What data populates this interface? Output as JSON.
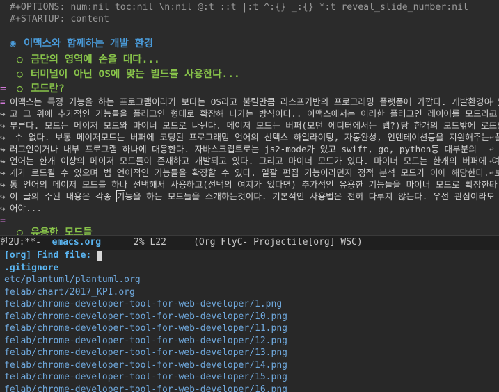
{
  "editor": {
    "options_line": "#+OPTIONS: num:nil toc:nil \\n:nil @:t ::t |:t ^:{} _:{} *:t reveal_slide_number:nil",
    "startup_line": "#+STARTUP: content",
    "h1": {
      "bullet": "◉",
      "text": "이맥스와 함께하는 개발 환경"
    },
    "h2a": {
      "bullet": "○",
      "text": "금단의 영역에 손을 대다..."
    },
    "h2b": {
      "bullet": "○",
      "text": "터미널이 아닌 OS에 맞는 빌드를 사용한다..."
    },
    "h2c": {
      "bullet": "○",
      "text": "모드란?"
    },
    "para": [
      "이맥스는 특정 기능을 하는 프로그램이라기 보다는 OS라고 불릴만큼 리스프기반의 프로그래밍 플랫폼에 가깝다. 개발환경이 있",
      "고 그 위에 추가적인 기능들을 플러그인 형태로 확장해 나가는 방식이다.. 이맥스에서는 이러한 플러그인 레이어를 모드라고",
      "부른다. 모드는 메이저 모드와 마이너 모드로 나뉜다. 메이저 모드는 버퍼(모던 에디터에서는 탭?)당 한개의 모드밖에 로드할",
      " 수 없다. 보통 메이저모드는 버퍼에 코딩된 프로그래밍 언어의 신택스 하일라이팅, 자동완성, 인덴테이션등을 지원해주는 플",
      "러그인이거나 내부 프로그램 하나에 대응한다. 자바스크립트로는 js2-mode가 있고 swift, go, python등 대부분의",
      "언어는 한개 이상의 메이저 모드들이 존재하고 개발되고 있다. 그리고 마이너 모드가 있다. 마이너 모드는 한개의 버퍼에 여러",
      "개가 로드될 수 있으며 범 언어적인 기능들을 확장할 수 있다. 일괄 편집 기능이라던지 정적 분석 모드가 이에 해당한다. 보",
      "통 언어의 메이저 모드를 하나 선택해서 사용하고(선택의 여지가 있다면) 추가적인 유용한 기능들을 마이너 모드로 확장한다.",
      "이 글의 주된 내용은 각종 ",
      "어야..."
    ],
    "para_line8_cursor": "기",
    "para_line8_rest": "능을 하는 모드들을 소개하는것이다. 기본적인 사용법은 전혀 다루지 않는다. 우선 관심이라도 끌",
    "h2d": {
      "bullet": "○",
      "text": "유용한 모드들"
    }
  },
  "modeline": {
    "state": "한2U:**-  ",
    "buffer": "emacs.org",
    "position": "      2% L22     (Org FlyC- Projectile[org] WSC)"
  },
  "minibuffer": {
    "prompt": "[org] Find file: ",
    "items": [
      ".gitignore",
      "etc/plantuml/plantuml.org",
      "felab/chart/2017_KPI.org",
      "felab/chrome-developer-tool-for-web-developer/1.png",
      "felab/chrome-developer-tool-for-web-developer/10.png",
      "felab/chrome-developer-tool-for-web-developer/11.png",
      "felab/chrome-developer-tool-for-web-developer/12.png",
      "felab/chrome-developer-tool-for-web-developer/13.png",
      "felab/chrome-developer-tool-for-web-developer/14.png",
      "felab/chrome-developer-tool-for-web-developer/15.png",
      "felab/chrome-developer-tool-for-web-developer/16.png"
    ]
  }
}
